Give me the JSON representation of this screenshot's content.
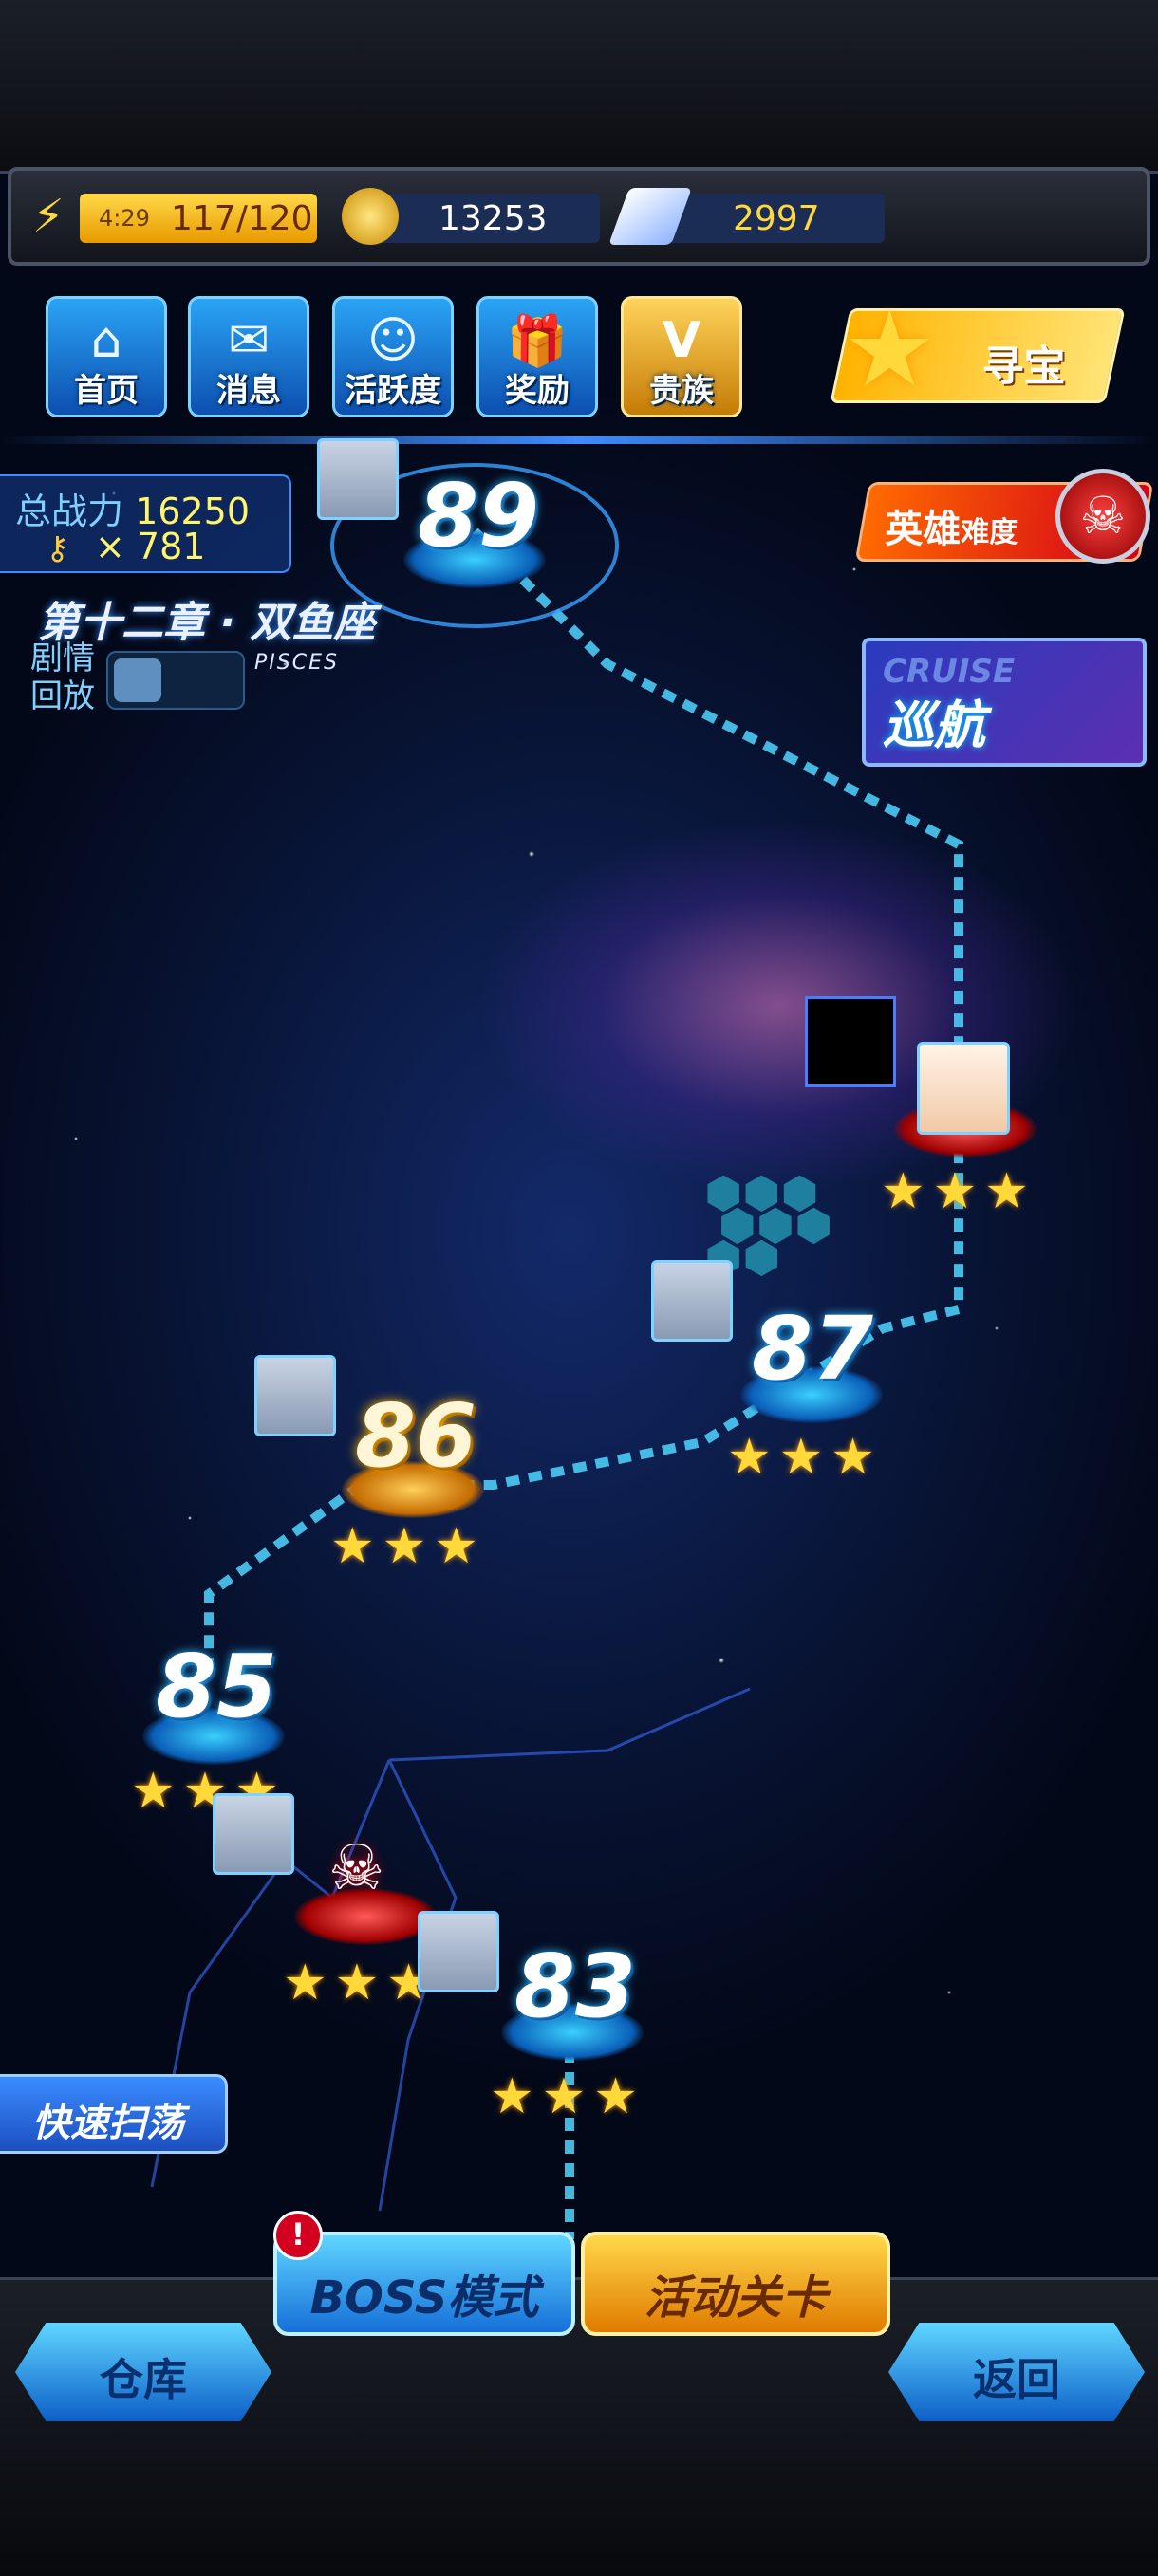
{
  "resources": {
    "energy_timer": "4:29",
    "energy": "117/120",
    "coins": "13253",
    "diamonds": "2997"
  },
  "nav": [
    {
      "label": "首页",
      "icon": "home-icon",
      "glyph": "⌂"
    },
    {
      "label": "消息",
      "icon": "mail-icon",
      "glyph": "✉"
    },
    {
      "label": "活跃度",
      "icon": "smile-wings-icon",
      "glyph": "☺"
    },
    {
      "label": "奖励",
      "icon": "gift-icon",
      "glyph": "🎁"
    },
    {
      "label": "贵族",
      "icon": "v-badge-icon",
      "glyph": "V"
    }
  ],
  "treasure_label": "寻宝",
  "power": {
    "label": "总战力",
    "value": "16250",
    "keys": "× 781"
  },
  "chapter": {
    "title": "第十二章 · 双鱼座",
    "subtitle": "PISCES"
  },
  "replay_label": [
    "剧情",
    "回放"
  ],
  "hero_mode": {
    "label_big": "英雄",
    "label_small": "难度"
  },
  "cruise": {
    "en": "CRUISE",
    "label": "巡航"
  },
  "levels": [
    {
      "num": "89",
      "stars": ""
    },
    {
      "num": "87",
      "stars": "★★★"
    },
    {
      "num": "86",
      "stars": "★★★"
    },
    {
      "num": "85",
      "stars": "★★★"
    },
    {
      "num": "83",
      "stars": "★★★"
    }
  ],
  "boss_node_stars": "★★★",
  "locked_node_stars": "★★★",
  "quick_sweep": "快速扫荡",
  "boss_mode": "BOSS模式",
  "activity_stage": "活动关卡",
  "alert_mark": "!",
  "warehouse": "仓库",
  "back": "返回"
}
